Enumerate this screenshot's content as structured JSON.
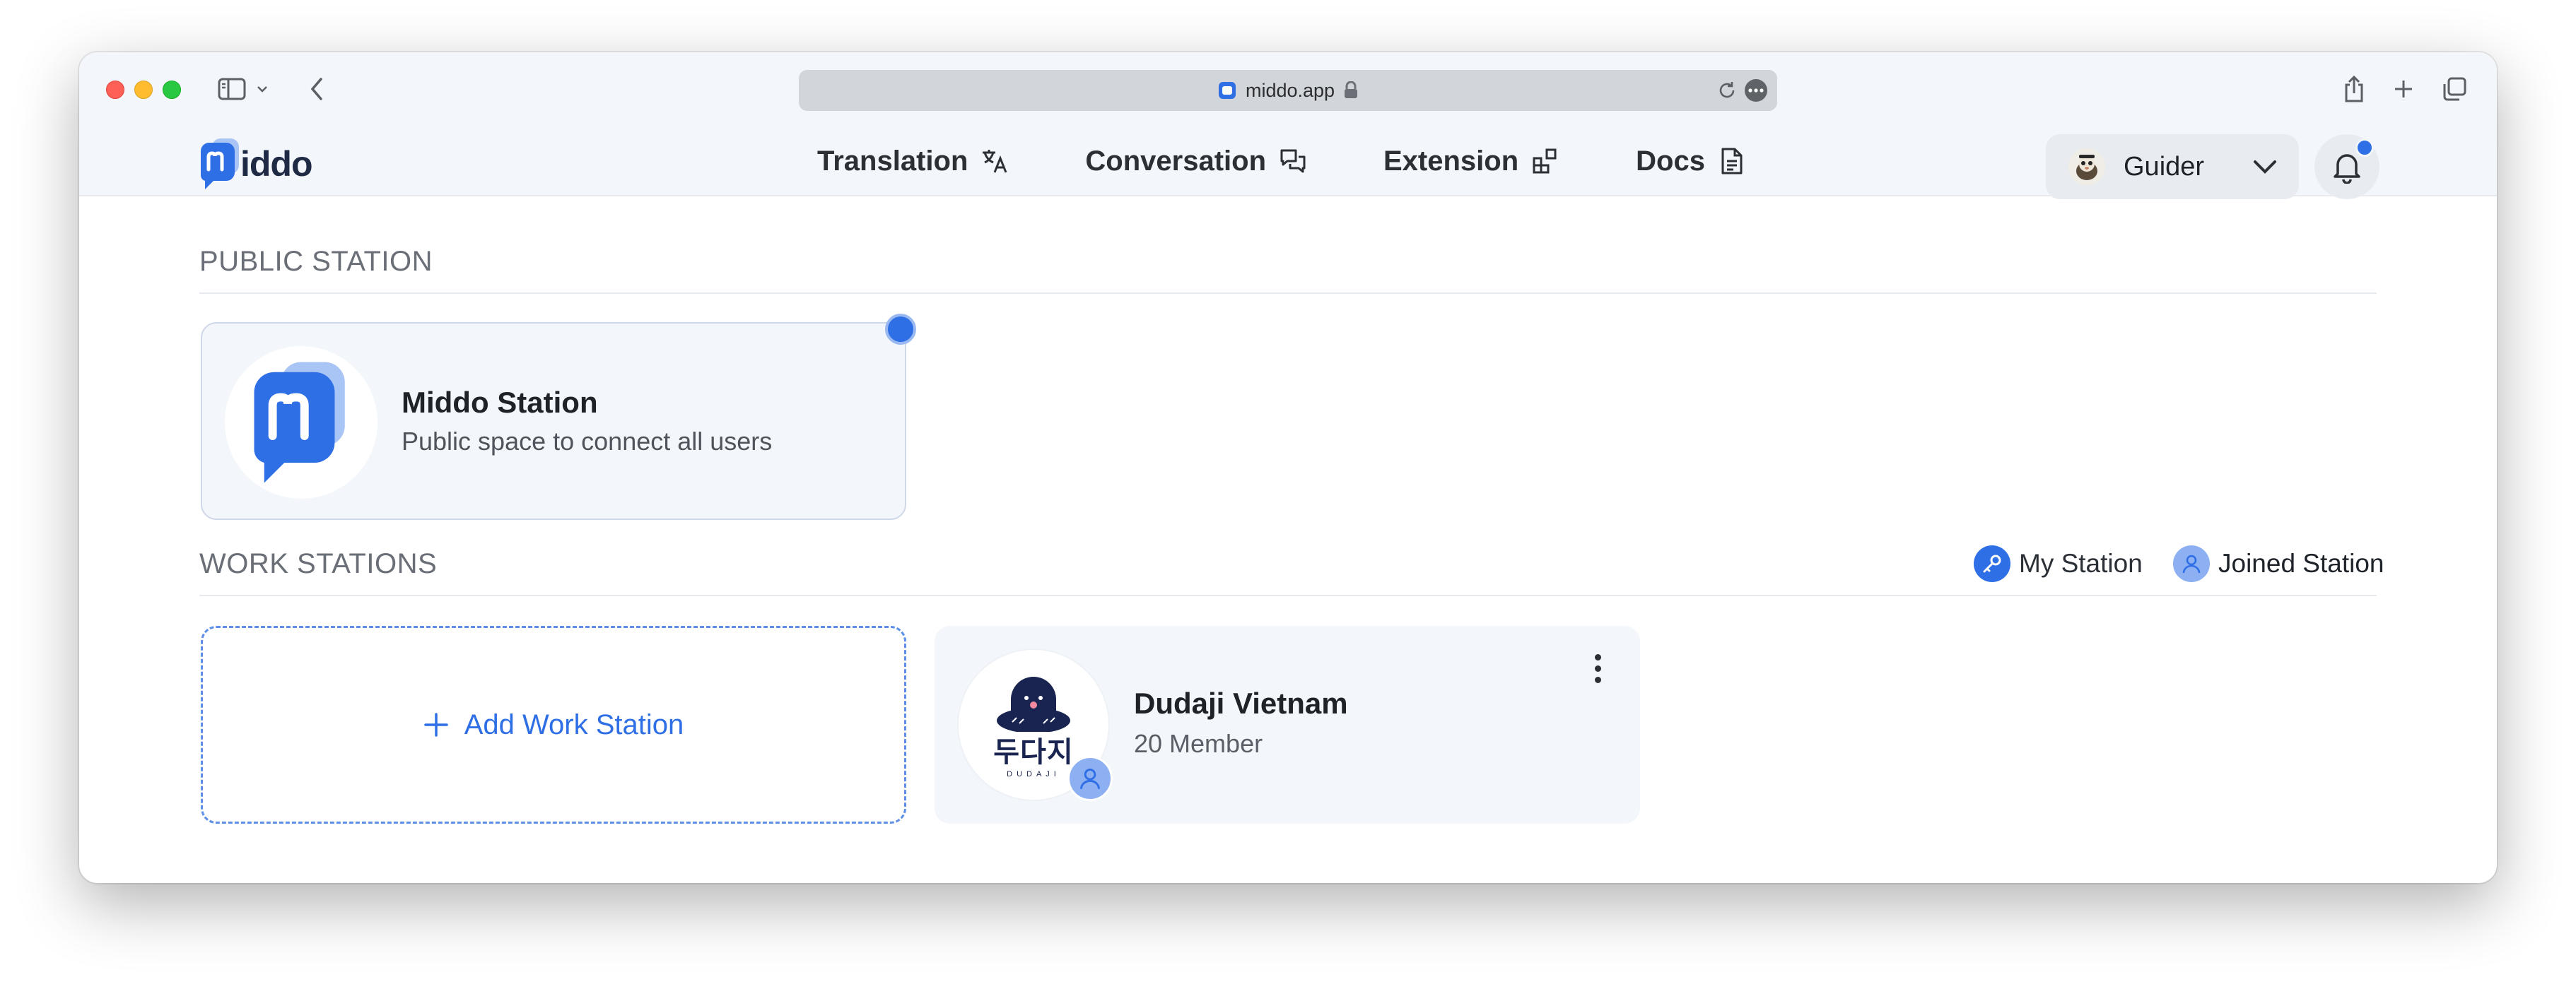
{
  "browser": {
    "address": "middo.app"
  },
  "header": {
    "logo_text": "iddo",
    "nav": [
      {
        "label": "Translation",
        "icon": "translate-icon"
      },
      {
        "label": "Conversation",
        "icon": "chat-bubbles-icon"
      },
      {
        "label": "Extension",
        "icon": "extension-icon"
      },
      {
        "label": "Docs",
        "icon": "document-icon"
      }
    ],
    "user": {
      "name": "Guider"
    }
  },
  "public_section": {
    "title": "PUBLIC STATION",
    "card": {
      "name": "Middo Station",
      "description": "Public space to connect all users"
    }
  },
  "work_section": {
    "title": "WORK STATIONS",
    "legend": {
      "my": "My Station",
      "joined": "Joined Station"
    },
    "add_label": "Add Work Station",
    "stations": [
      {
        "name": "Dudaji Vietnam",
        "members": "20 Member",
        "logo_text": "두다지",
        "logo_sub": "DUDAJI"
      }
    ]
  },
  "colors": {
    "accent": "#2f6fe6",
    "joined": "#8db0f2",
    "surface": "#f3f6fa"
  }
}
